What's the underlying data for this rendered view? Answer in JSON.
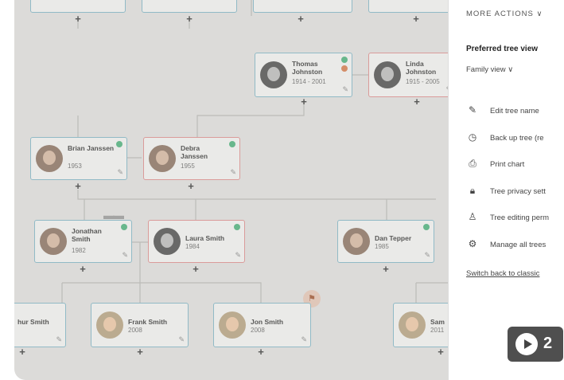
{
  "panel": {
    "more_actions": "MORE ACTIONS ∨",
    "preferred_title": "Preferred tree view",
    "family_view": "Family view ∨",
    "menu": [
      {
        "label": "Edit tree name",
        "icon": "pencil-icon"
      },
      {
        "label": "Back up tree (re",
        "icon": "clock-icon"
      },
      {
        "label": "Print chart",
        "icon": "printer-icon"
      },
      {
        "label": "Tree privacy sett",
        "icon": "lock-icon"
      },
      {
        "label": "Tree editing perm",
        "icon": "person-icon"
      },
      {
        "label": "Manage all trees",
        "icon": "gear-icon"
      }
    ],
    "switch_link": "Switch back to classic"
  },
  "tree": {
    "thomas": {
      "name": "Thomas Johnston",
      "years": "1914 - 2001"
    },
    "linda": {
      "name": "Linda Johnston",
      "years": "1915 - 2005"
    },
    "brian": {
      "name": "Brian Janssen",
      "years": "1953"
    },
    "debra": {
      "name": "Debra Janssen",
      "years": "1955"
    },
    "jonathan": {
      "name": "Jonathan Smith",
      "years": "1982"
    },
    "laura": {
      "name": "Laura Smith",
      "years": "1984"
    },
    "dan": {
      "name": "Dan Tepper",
      "years": "1985"
    },
    "arthur": {
      "name": "hur Smith",
      "years": ""
    },
    "frank": {
      "name": "Frank Smith",
      "years": "2008"
    },
    "jon": {
      "name": "Jon Smith",
      "years": "2008"
    },
    "sam": {
      "name": "Sam",
      "years": "2011"
    }
  },
  "plus_label": "+",
  "edit_glyph": "✎",
  "video": {
    "counter": "2"
  },
  "colors": {
    "male_border": "#7fb6c7",
    "female_border": "#e08c8c",
    "hint": "#49b27a"
  }
}
